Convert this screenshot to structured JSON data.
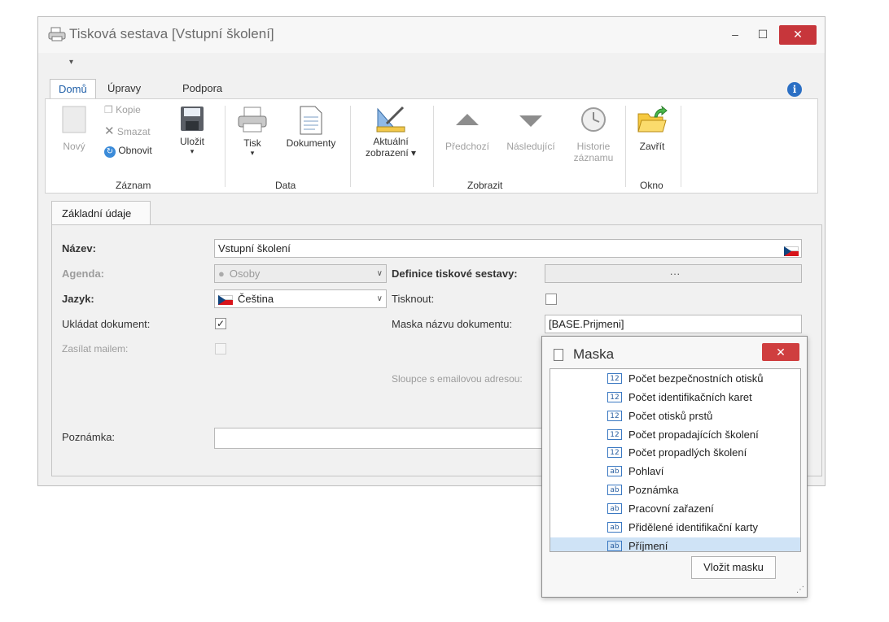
{
  "window": {
    "title": "Tisková sestava [Vstupní školení]",
    "min_glyph": "–",
    "max_glyph": "☐",
    "close_glyph": "✕",
    "qat_glyph": "▾"
  },
  "ribbon": {
    "tabs": [
      "Domů",
      "Úpravy",
      "Podpora"
    ],
    "info_glyph": "i",
    "groups": [
      {
        "label": "Záznam"
      },
      {
        "label": "Data"
      },
      {
        "label": "Zobrazit"
      },
      {
        "label": "Okno"
      }
    ],
    "buttons": {
      "new": "Nový",
      "copy": "Kopie",
      "delete": "Smazat",
      "refresh": "Obnovit",
      "save": "Uložit",
      "print": "Tisk",
      "documents": "Dokumenty",
      "current_view_line1": "Aktuální",
      "current_view_line2": "zobrazení ▾",
      "previous": "Předchozí",
      "next": "Následující",
      "history_line1": "Historie",
      "history_line2": "záznamu",
      "close": "Zavřít"
    },
    "dropdown_glyph": "▾"
  },
  "form": {
    "tab": "Základní údaje",
    "name_label": "Název:",
    "name_value": "Vstupní školení",
    "agenda_label": "Agenda:",
    "agenda_value": "Osoby",
    "definition_label": "Definice tiskové sestavy:",
    "definition_value": "···",
    "language_label": "Jazyk:",
    "language_value": "Čeština",
    "print_label": "Tisknout:",
    "save_doc_label": "Ukládat dokument:",
    "save_doc_checked": true,
    "check_glyph": "✓",
    "mask_label": "Maska názvu dokumentu:",
    "mask_value": "[BASE.Prijmeni]",
    "send_mail_label": "Zasílat mailem:",
    "email_columns_label": "Sloupce s emailovou adresou:",
    "note_label": "Poznámka:",
    "note_value": "",
    "combo_arrow": "∨"
  },
  "mask_dialog": {
    "title": "Maska",
    "close_glyph": "✕",
    "items": [
      {
        "type": "12",
        "label": "Počet bezpečnostních otisků"
      },
      {
        "type": "12",
        "label": "Počet identifikačních karet"
      },
      {
        "type": "12",
        "label": "Počet otisků prstů"
      },
      {
        "type": "12",
        "label": "Počet propadajících školení"
      },
      {
        "type": "12",
        "label": "Počet propadlých školení"
      },
      {
        "type": "ab",
        "label": "Pohlaví"
      },
      {
        "type": "ab",
        "label": "Poznámka"
      },
      {
        "type": "ab",
        "label": "Pracovní zařazení"
      },
      {
        "type": "ab",
        "label": "Přidělené identifikační karty"
      },
      {
        "type": "ab",
        "label": "Příjmení",
        "selected": true
      }
    ],
    "insert_button": "Vložit masku",
    "grip_glyph": "⋰"
  }
}
